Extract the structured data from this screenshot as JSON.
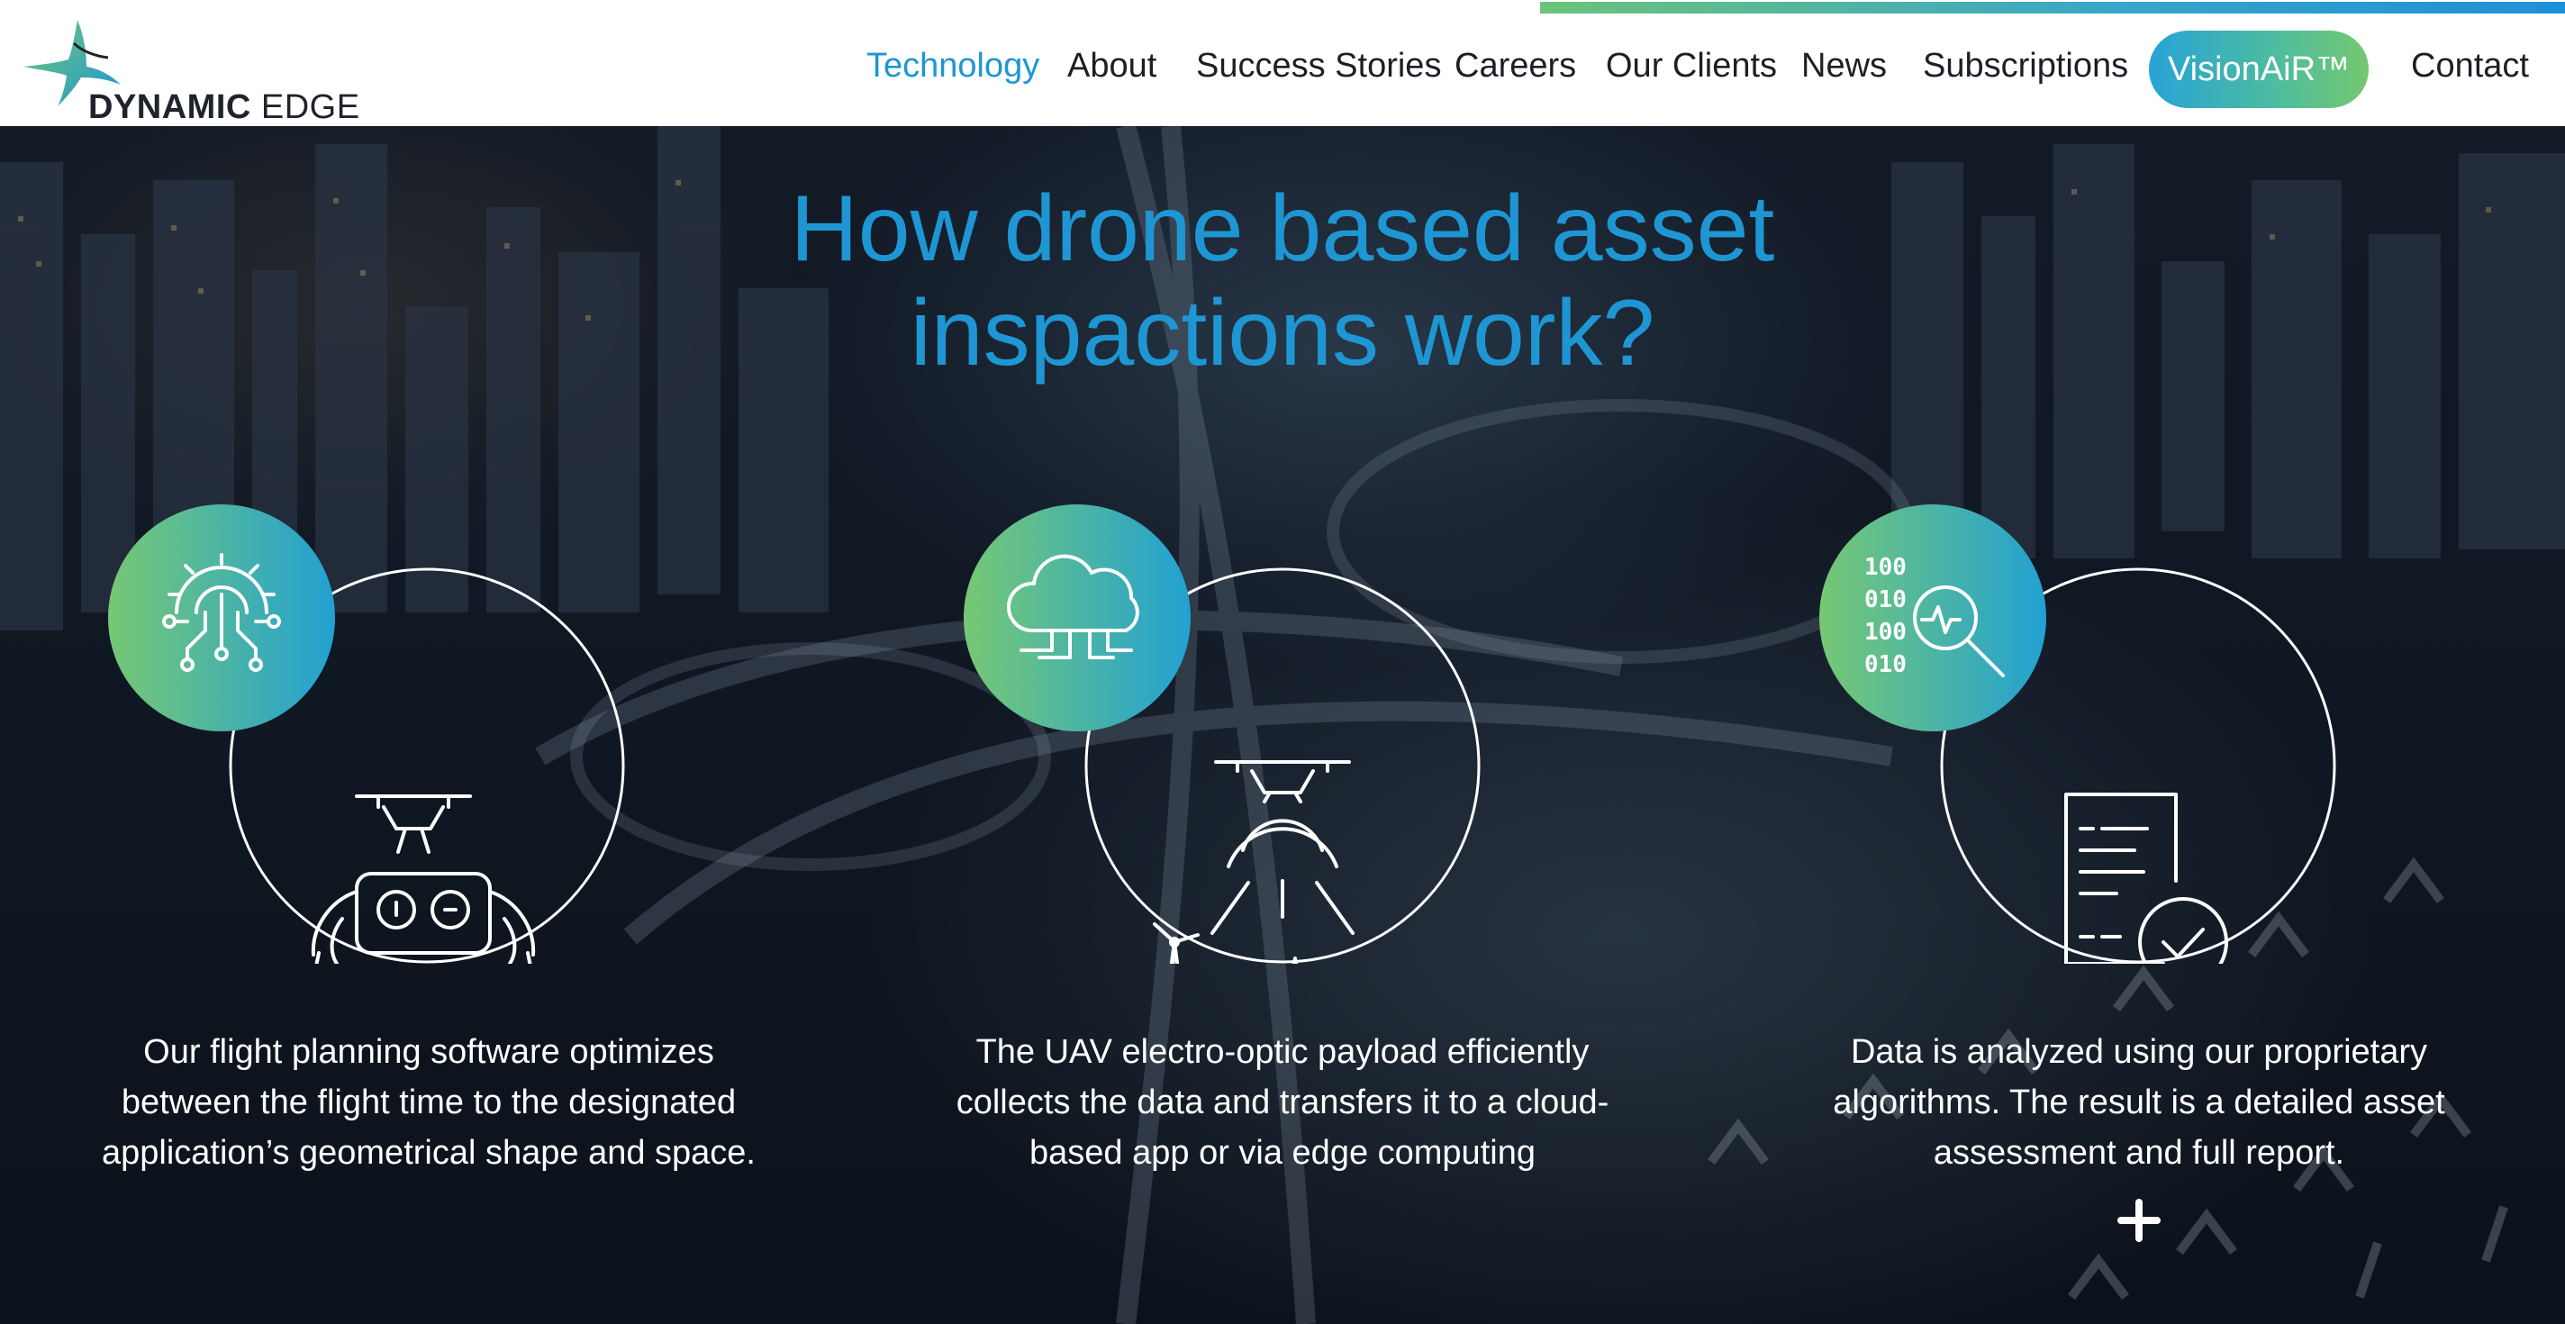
{
  "header": {
    "logo_text_bold": "DYNAMIC",
    "logo_text_light": "EDGE",
    "nav": [
      {
        "label": "Technology",
        "active": true
      },
      {
        "label": "About"
      },
      {
        "label": "Success Stories"
      },
      {
        "label": "Careers"
      },
      {
        "label": "Our Clients"
      },
      {
        "label": "News"
      },
      {
        "label": "Subscriptions"
      }
    ],
    "cta_label": "VisionAiR™",
    "contact_label": "Contact"
  },
  "hero": {
    "title_line1": "How drone based asset",
    "title_line2": "inspactions work?",
    "steps": [
      {
        "badge_icon": "gear-circuit-icon",
        "main_icon": "drone-remote-control-icon",
        "description": "Our flight planning software optimizes between the flight time to the designated application’s geometrical shape and space."
      },
      {
        "badge_icon": "cloud-icon",
        "main_icon": "drone-scanning-assets-icon",
        "description": "The UAV electro-optic payload efficiently collects the data and transfers it to a cloud-based app or via edge computing"
      },
      {
        "badge_icon": "binary-data-analysis-icon",
        "badge_digits": [
          "100",
          "010",
          "100",
          "010"
        ],
        "main_icon": "report-checkmark-icon",
        "description": "Data is analyzed using our proprietary algorithms. The result is a detailed asset assessment and full report."
      }
    ],
    "expand_icon": "plus-icon"
  },
  "colors": {
    "accent_blue": "#1e96d3",
    "gradient_green": "#76c86f",
    "gradient_blue": "#1e90d6"
  }
}
